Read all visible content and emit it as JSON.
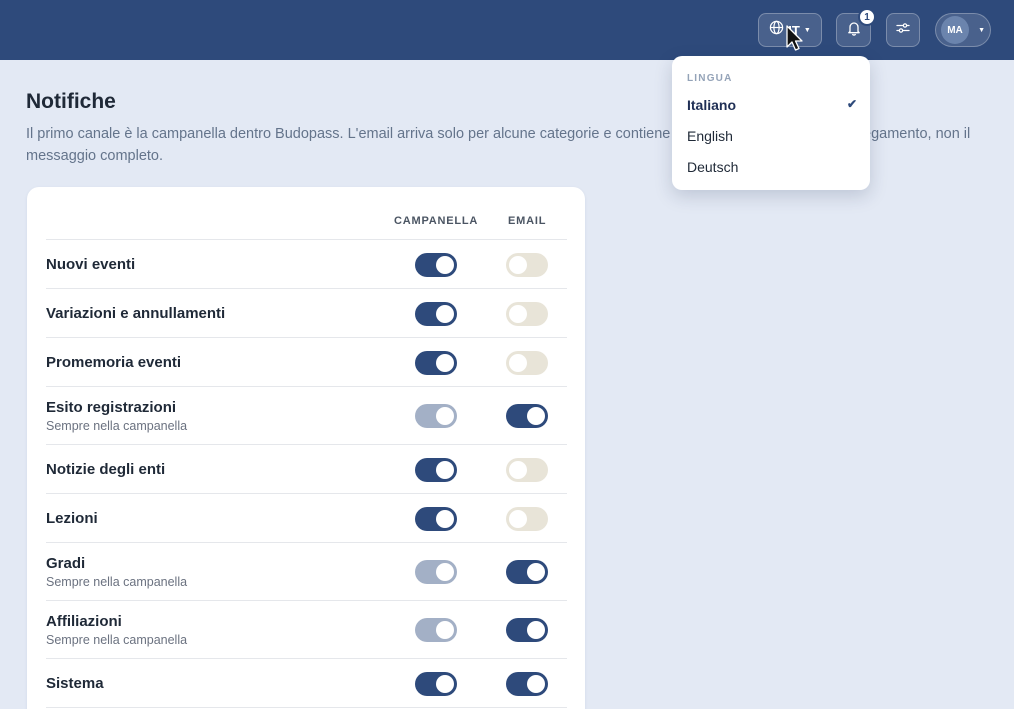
{
  "header": {
    "lang_code": "IT",
    "notification_count": "1",
    "avatar_initials": "MA"
  },
  "page": {
    "title": "Notifiche",
    "description": "Il primo canale è la campanella dentro Budopass. L'email arriva solo per alcune categorie e contiene un breve riepilogo con un collegamento, non il messaggio completo."
  },
  "table": {
    "col_bell": "CAMPANELLA",
    "col_email": "EMAIL",
    "rows": [
      {
        "label": "Nuovi eventi",
        "sublabel": "",
        "bell": "on",
        "email": "off"
      },
      {
        "label": "Variazioni e annullamenti",
        "sublabel": "",
        "bell": "on",
        "email": "off"
      },
      {
        "label": "Promemoria eventi",
        "sublabel": "",
        "bell": "on",
        "email": "off"
      },
      {
        "label": "Esito registrazioni",
        "sublabel": "Sempre nella campanella",
        "bell": "locked",
        "email": "on"
      },
      {
        "label": "Notizie degli enti",
        "sublabel": "",
        "bell": "on",
        "email": "off"
      },
      {
        "label": "Lezioni",
        "sublabel": "",
        "bell": "on",
        "email": "off"
      },
      {
        "label": "Gradi",
        "sublabel": "Sempre nella campanella",
        "bell": "locked",
        "email": "on"
      },
      {
        "label": "Affiliazioni",
        "sublabel": "Sempre nella campanella",
        "bell": "locked",
        "email": "on"
      },
      {
        "label": "Sistema",
        "sublabel": "",
        "bell": "on",
        "email": "on"
      }
    ]
  },
  "language_menu": {
    "title": "LINGUA",
    "items": [
      {
        "label": "Italiano",
        "selected": true
      },
      {
        "label": "English",
        "selected": false
      },
      {
        "label": "Deutsch",
        "selected": false
      }
    ]
  },
  "colors": {
    "header_bg": "#2e4a7b",
    "toggle_on": "#2e4a7b",
    "toggle_off": "#e8e4d8",
    "toggle_locked": "#a3b0c6",
    "page_bg": "#e3e9f4"
  }
}
